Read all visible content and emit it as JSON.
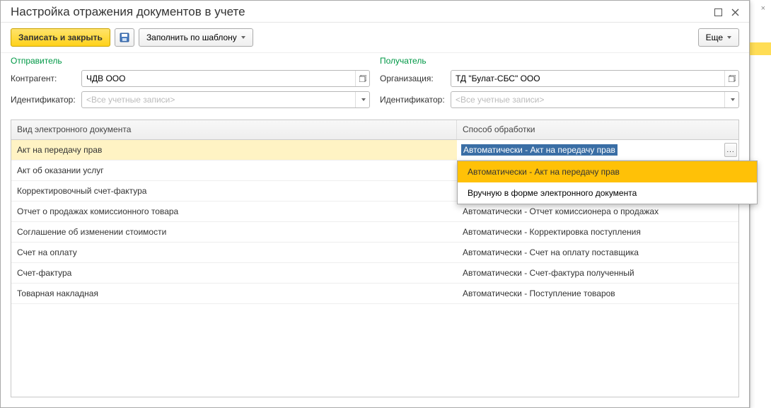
{
  "window": {
    "title": "Настройка отражения документов в учете"
  },
  "toolbar": {
    "save_close": "Записать и закрыть",
    "fill_template": "Заполнить по шаблону",
    "more": "Еще"
  },
  "sender": {
    "section": "Отправитель",
    "counterparty_label": "Контрагент:",
    "counterparty_value": "ЧДВ ООО",
    "id_label": "Идентификатор:",
    "id_placeholder": "<Все учетные записи>"
  },
  "recipient": {
    "section": "Получатель",
    "org_label": "Организация:",
    "org_value": "ТД \"Булат-СБС\" ООО",
    "id_label": "Идентификатор:",
    "id_placeholder": "<Все учетные записи>"
  },
  "table": {
    "col_doc": "Вид электронного документа",
    "col_proc": "Способ обработки",
    "rows": [
      {
        "doc": "Акт на передачу прав",
        "proc": "Автоматически -  Акт на передачу прав"
      },
      {
        "doc": "Акт об оказании услуг",
        "proc": ""
      },
      {
        "doc": "Корректировочный счет-фактура",
        "proc": ""
      },
      {
        "doc": "Отчет о продажах комиссионного товара",
        "proc": "Автоматически -  Отчет комиссионера о продажах"
      },
      {
        "doc": "Соглашение об изменении стоимости",
        "proc": "Автоматически -  Корректировка поступления"
      },
      {
        "doc": "Счет на оплату",
        "proc": "Автоматически -  Счет на оплату поставщика"
      },
      {
        "doc": "Счет-фактура",
        "proc": "Автоматически -  Счет-фактура полученный"
      },
      {
        "doc": "Товарная накладная",
        "proc": "Автоматически -  Поступление товаров"
      }
    ],
    "selected_index": 0,
    "dropdown": [
      "Автоматически -  Акт на передачу прав",
      "Вручную в форме электронного документа"
    ],
    "dropdown_hover_index": 0
  }
}
